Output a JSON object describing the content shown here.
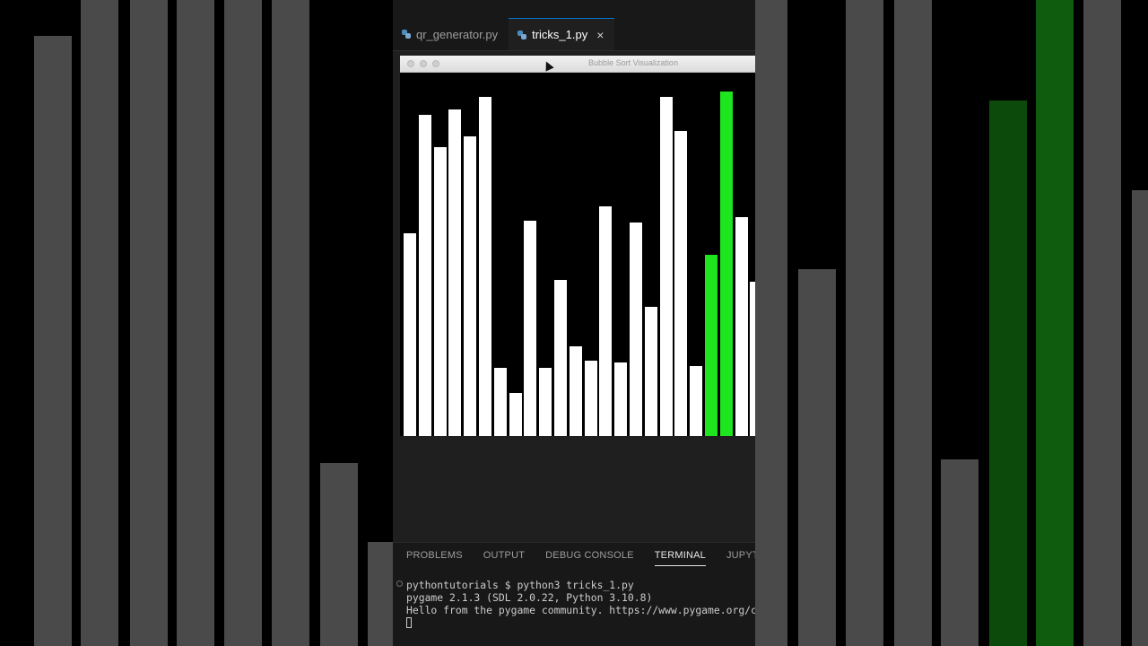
{
  "editor": {
    "tabs": [
      {
        "label": "qr_generator.py",
        "active": false
      },
      {
        "label": "tricks_1.py",
        "active": true
      }
    ],
    "close_glyph": "×"
  },
  "pygame_window": {
    "title": "Bubble Sort Visualization"
  },
  "chart_data": {
    "type": "bar",
    "values": [
      226,
      358,
      322,
      364,
      334,
      378,
      76,
      48,
      240,
      76,
      174,
      100,
      84,
      256,
      82,
      238,
      144,
      378,
      340,
      78,
      202,
      384,
      244,
      172
    ],
    "ylim": [
      0,
      406
    ],
    "highlighted_indices": [
      20,
      21
    ],
    "colors": {
      "default": "#ffffff",
      "highlight": "#1ee51e"
    }
  },
  "panel": {
    "tabs": [
      {
        "label": "PROBLEMS",
        "active": false
      },
      {
        "label": "OUTPUT",
        "active": false
      },
      {
        "label": "DEBUG CONSOLE",
        "active": false
      },
      {
        "label": "TERMINAL",
        "active": true
      },
      {
        "label": "JUPYTER",
        "active": false
      }
    ]
  },
  "terminal": {
    "lines": [
      "pythontutorials $ python3 tricks_1.py",
      "pygame 2.1.3 (SDL 2.0.22, Python 3.10.8)",
      "Hello from the pygame community. https://www.pygame.org/co"
    ]
  }
}
